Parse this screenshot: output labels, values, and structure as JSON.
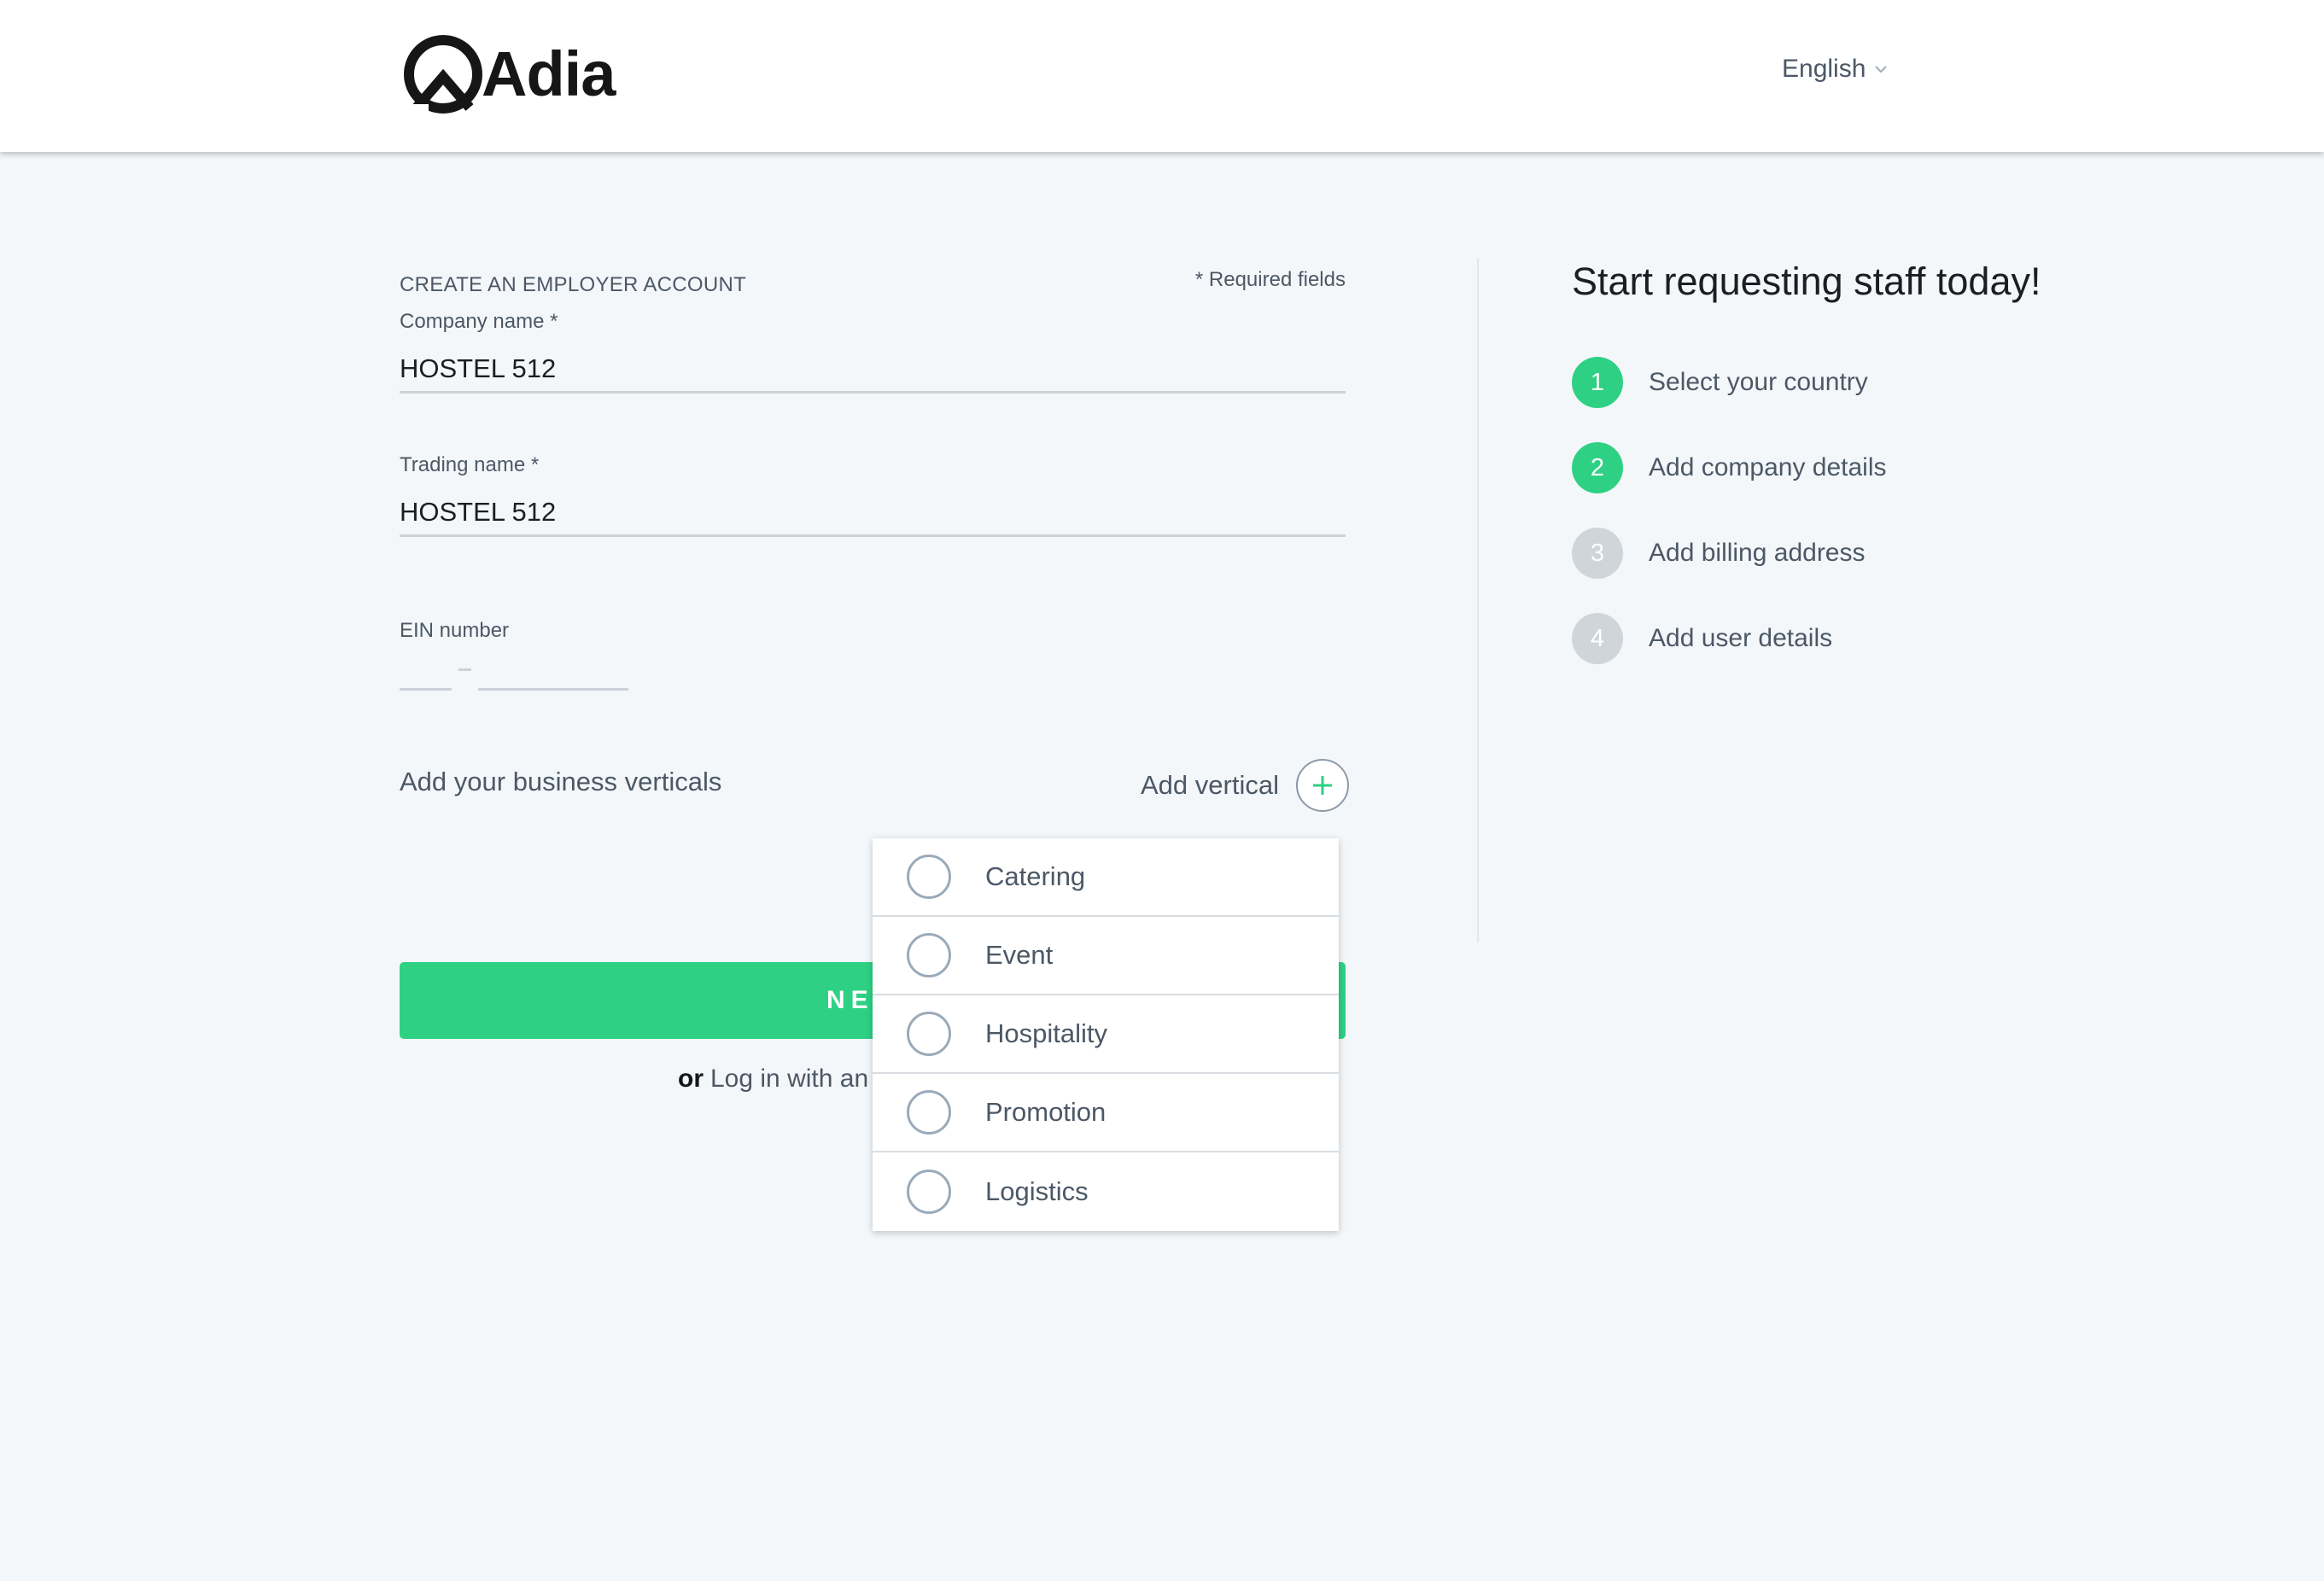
{
  "header": {
    "logo_text": "Adia",
    "language": "English"
  },
  "form": {
    "title": "CREATE AN EMPLOYER ACCOUNT",
    "required_note": "* Required fields",
    "company_name": {
      "label": "Company name *",
      "value": "HOSTEL 512"
    },
    "trading_name": {
      "label": "Trading name *",
      "value": "HOSTEL 512"
    },
    "ein": {
      "label": "EIN number",
      "part1": "",
      "part2": ""
    },
    "verticals_label": "Add your business verticals",
    "add_vertical_label": "Add vertical",
    "next_button": "NEXT",
    "login_or": "or",
    "login_link": "Log in with an existing account"
  },
  "verticals_dropdown": {
    "options": [
      "Catering",
      "Event",
      "Hospitality",
      "Promotion",
      "Logistics"
    ]
  },
  "steps": {
    "title": "Start requesting staff today!",
    "items": [
      {
        "number": "1",
        "label": "Select your country",
        "state": "done"
      },
      {
        "number": "2",
        "label": "Add company details",
        "state": "done"
      },
      {
        "number": "3",
        "label": "Add billing address",
        "state": "todo"
      },
      {
        "number": "4",
        "label": "Add user details",
        "state": "todo"
      }
    ]
  },
  "colors": {
    "accent_green": "#2ed184",
    "step_inactive": "#d0d5da",
    "text_muted": "#4c5866",
    "background": "#f4f7fa"
  },
  "icons": {
    "logo": "adia-logo-icon",
    "language_chevron": "chevron-down-icon",
    "add_vertical": "plus-icon",
    "dropdown_option": "radio-circle-icon"
  }
}
